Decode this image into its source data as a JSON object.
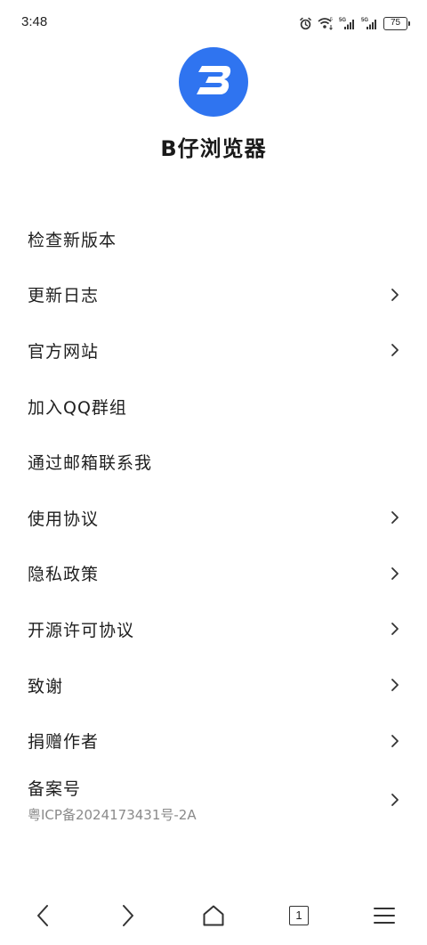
{
  "status_bar": {
    "time": "3:48",
    "icons": [
      "alarm-icon",
      "wifi-icon",
      "signal-5g-icon",
      "signal-5g-icon"
    ],
    "battery": "75"
  },
  "header": {
    "logo_icon": "b-logo-icon",
    "app_name": "B仔浏览器",
    "accent_color": "#2f74f0"
  },
  "menu": {
    "check_update": "检查新版本",
    "changelog": "更新日志",
    "website": "官方网站",
    "qq_group": "加入QQ群组",
    "email": "通过邮箱联系我",
    "terms": "使用协议",
    "privacy": "隐私政策",
    "licenses": "开源许可协议",
    "thanks": "致谢",
    "donate": "捐赠作者",
    "icp_label": "备案号",
    "icp_value": "粤ICP备2024173431号-2A"
  },
  "bottom_nav": {
    "back": "back-icon",
    "forward": "forward-icon",
    "home": "home-icon",
    "tabs_count": "1",
    "menu": "menu-icon"
  }
}
